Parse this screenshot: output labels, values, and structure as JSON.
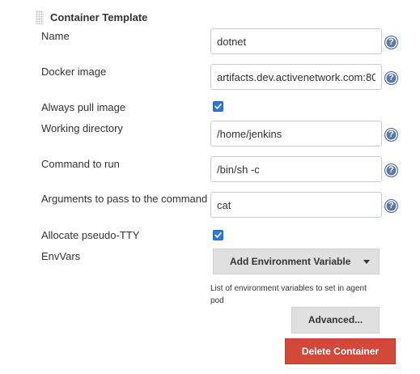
{
  "section": {
    "title": "Container Template"
  },
  "fields": {
    "name": {
      "label": "Name",
      "value": "dotnet"
    },
    "docker_image": {
      "label": "Docker image",
      "value": "artifacts.dev.activenetwork.com:80"
    },
    "always_pull": {
      "label": "Always pull image",
      "checked": true
    },
    "working_dir": {
      "label": "Working directory",
      "value": "/home/jenkins"
    },
    "command": {
      "label": "Command to run",
      "value": "/bin/sh -c"
    },
    "arguments": {
      "label": "Arguments to pass to the command",
      "value": "cat"
    },
    "tty": {
      "label": "Allocate pseudo-TTY",
      "checked": true
    },
    "envvars": {
      "label": "EnvVars",
      "add_button": "Add Environment Variable",
      "description": "List of environment variables to set in agent pod"
    }
  },
  "help_icon_glyph": "?",
  "buttons": {
    "advanced": "Advanced...",
    "delete": "Delete Container"
  },
  "colors": {
    "checkbox": "#2a7ad6",
    "help_icon": "#5a7aa8",
    "delete_button": "#d24939",
    "grey_button": "#e0e0e0"
  }
}
